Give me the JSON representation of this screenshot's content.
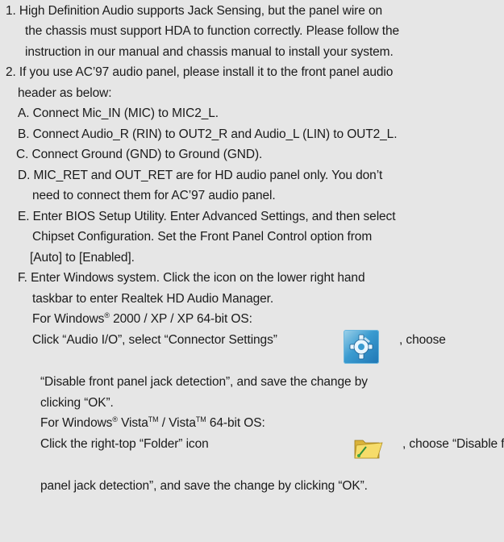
{
  "lines": {
    "l1": "1. High Definition Audio supports Jack Sensing, but the panel wire on",
    "l2": "the chassis must support HDA to function correctly. Please follow the",
    "l3": "instruction in our manual and chassis manual to install your system.",
    "l4": "2. If you use AC’97 audio panel, please install it to the front panel audio",
    "l5": "header as below:",
    "l6": "A. Connect Mic_IN (MIC) to MIC2_L.",
    "l7": "B. Connect Audio_R (RIN) to OUT2_R and Audio_L (LIN) to OUT2_L.",
    "l8": "C. Connect Ground (GND) to Ground (GND).",
    "l9": "D. MIC_RET and OUT_RET are for HD audio panel only. You don’t",
    "l10": "need to connect them for AC’97 audio panel.",
    "l11": "E. Enter BIOS Setup Utility. Enter Advanced Settings, and then select",
    "l12": "Chipset Configuration. Set the Front Panel Control option from",
    "l13": "[Auto] to [Enabled].",
    "l14": "F. Enter Windows system. Click the icon on the lower right hand",
    "l15": "taskbar to enter Realtek HD Audio Manager.",
    "l16a": "For Windows",
    "l16sup": "®",
    "l16b": " 2000 / XP / XP 64-bit OS:",
    "l17a": "Click “Audio I/O”, select “Connector Settings”",
    "l17b": ", choose",
    "l18": "“Disable front panel jack detection”, and save the change by",
    "l19": "clicking “OK”.",
    "l20a": "For Windows",
    "l20sup1": "®",
    "l20b": " Vista",
    "l20sup2": "TM",
    "l20c": " / Vista",
    "l20sup3": "TM",
    "l20d": " 64-bit OS:",
    "l21a": "Click the right-top “Folder” icon",
    "l21b": ", choose “Disable front",
    "l22": "panel jack detection”, and save the change by clicking “OK”."
  },
  "icons": {
    "connector_settings": "connector-settings-icon",
    "folder": "folder-icon"
  }
}
